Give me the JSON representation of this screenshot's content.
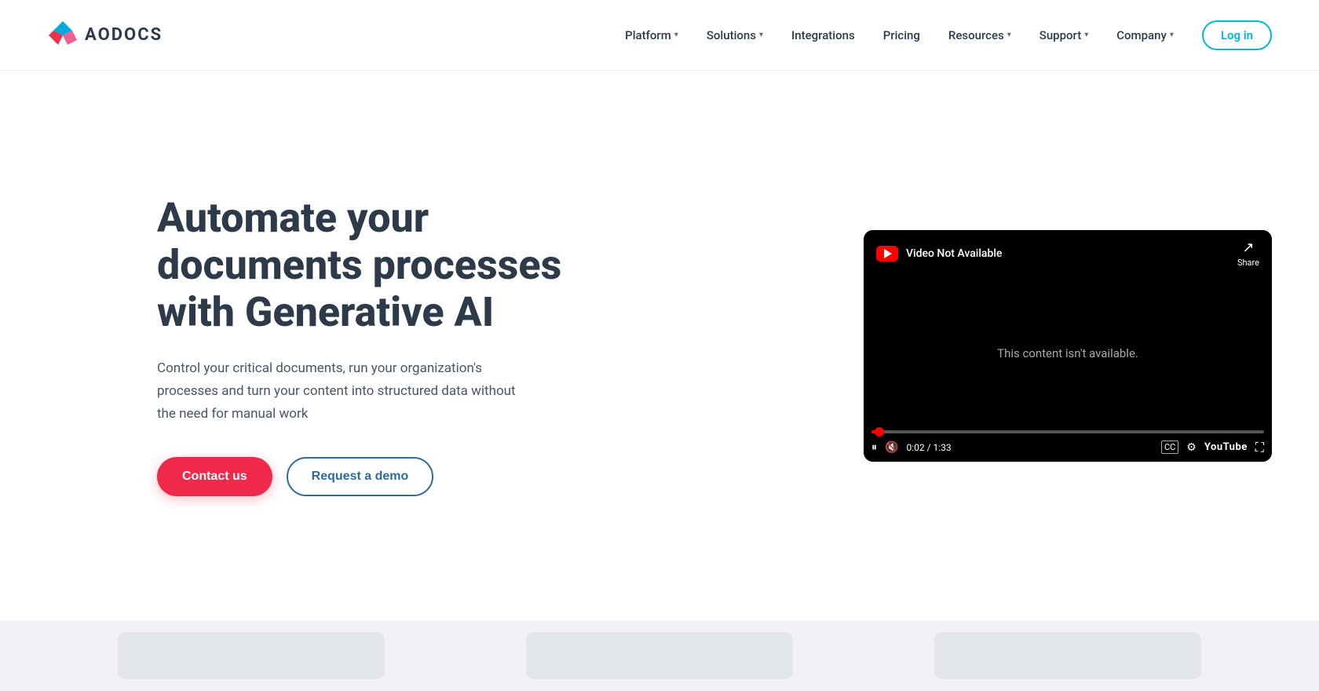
{
  "navbar": {
    "logo_text": "AODOCS",
    "nav_items": [
      {
        "id": "platform",
        "label": "Platform",
        "has_dropdown": true
      },
      {
        "id": "solutions",
        "label": "Solutions",
        "has_dropdown": true
      },
      {
        "id": "integrations",
        "label": "Integrations",
        "has_dropdown": false
      },
      {
        "id": "pricing",
        "label": "Pricing",
        "has_dropdown": false
      },
      {
        "id": "resources",
        "label": "Resources",
        "has_dropdown": true
      },
      {
        "id": "support",
        "label": "Support",
        "has_dropdown": true
      },
      {
        "id": "company",
        "label": "Company",
        "has_dropdown": true
      }
    ],
    "login_label": "Log in"
  },
  "hero": {
    "title": "Automate your documents processes with Generative AI",
    "description": "Control your critical documents, run your organization's processes and turn your content into structured data without the need for manual work",
    "contact_button": "Contact us",
    "demo_button": "Request a demo"
  },
  "video": {
    "not_available_label": "Video Not Available",
    "share_label": "Share",
    "unavailable_message": "This content isn't available.",
    "time_current": "0:02",
    "time_total": "1:33",
    "progress_percent": 2
  }
}
